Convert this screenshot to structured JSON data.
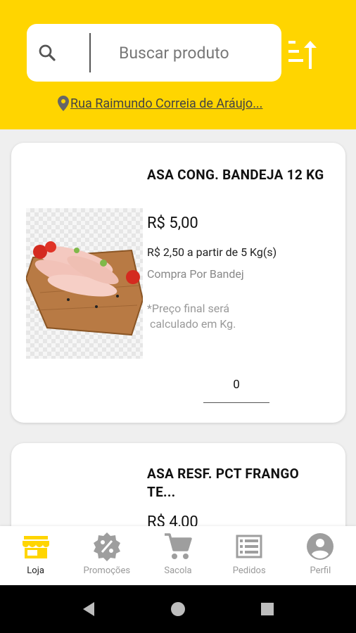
{
  "search": {
    "placeholder": "Buscar produto"
  },
  "address": {
    "text": "Rua Raimundo Correia de Aráujo..."
  },
  "products": [
    {
      "name": "ASA CONG. BANDEJA 12 KG",
      "price": "R$ 5,00",
      "promo": "R$ 2,50 a partir de 5 Kg(s)",
      "buy_type": "Compra Por Bandej",
      "note": "*Preço final será\n calculado em Kg.",
      "quantity": "0"
    },
    {
      "name": "ASA RESF. PCT FRANGO TE...",
      "price": "R$ 4,00"
    }
  ],
  "nav": {
    "items": [
      {
        "label": "Loja",
        "icon": "store-icon"
      },
      {
        "label": "Promoções",
        "icon": "discount-badge-icon"
      },
      {
        "label": "Sacola",
        "icon": "cart-icon"
      },
      {
        "label": "Pedidos",
        "icon": "list-icon"
      },
      {
        "label": "Perfil",
        "icon": "profile-icon"
      }
    ],
    "active_color": "#ffd500",
    "inactive_color": "#9e9e9e"
  },
  "colors": {
    "brand_yellow": "#ffd500"
  }
}
